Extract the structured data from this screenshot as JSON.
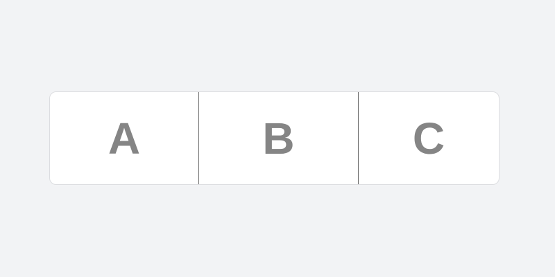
{
  "segmented_control": {
    "segments": [
      {
        "label": "A"
      },
      {
        "label": "B"
      },
      {
        "label": "C"
      }
    ],
    "label_color": "#858585",
    "background_color": "#ffffff",
    "divider_color": "#6e6e6e",
    "page_background": "#f2f3f5"
  }
}
